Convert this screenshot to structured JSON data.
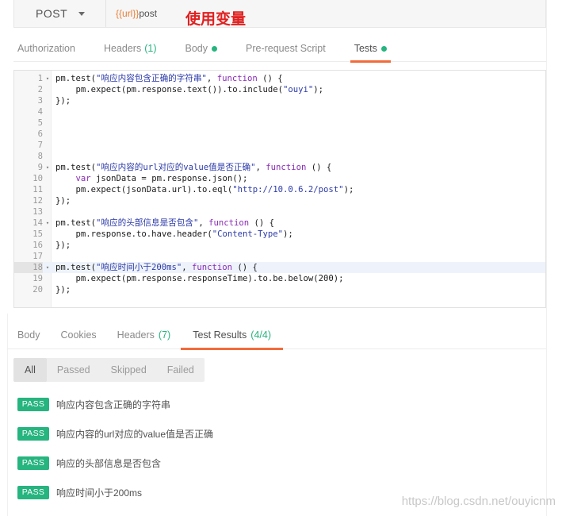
{
  "request": {
    "method": "POST",
    "url_var": "{{url}}",
    "url_rest": "post",
    "annotation": "使用变量"
  },
  "request_tabs": [
    {
      "label": "Authorization",
      "count": "",
      "dot": false,
      "active": false
    },
    {
      "label": "Headers",
      "count": "(1)",
      "dot": false,
      "active": false
    },
    {
      "label": "Body",
      "count": "",
      "dot": true,
      "active": false
    },
    {
      "label": "Pre-request Script",
      "count": "",
      "dot": false,
      "active": false
    },
    {
      "label": "Tests",
      "count": "",
      "dot": true,
      "active": true
    }
  ],
  "code_lines": [
    {
      "n": "1",
      "fold": true,
      "html": "pm.test(<span class=\"s\">\"响应内容包含正确的字符串\"</span>, <span class=\"k\">function</span> () {"
    },
    {
      "n": "2",
      "fold": false,
      "html": "    pm.expect(pm.response.text()).to.include(<span class=\"s\">\"ouyi\"</span>);"
    },
    {
      "n": "3",
      "fold": false,
      "html": "});"
    },
    {
      "n": "4",
      "fold": false,
      "html": ""
    },
    {
      "n": "5",
      "fold": false,
      "html": ""
    },
    {
      "n": "6",
      "fold": false,
      "html": ""
    },
    {
      "n": "7",
      "fold": false,
      "html": ""
    },
    {
      "n": "8",
      "fold": false,
      "html": ""
    },
    {
      "n": "9",
      "fold": true,
      "html": "pm.test(<span class=\"s\">\"响应内容的url对应的value值是否正确\"</span>, <span class=\"k\">function</span> () {"
    },
    {
      "n": "10",
      "fold": false,
      "html": "    <span class=\"k\">var</span> jsonData = pm.response.json();"
    },
    {
      "n": "11",
      "fold": false,
      "html": "    pm.expect(jsonData.url).to.eql(<span class=\"s\">\"http://10.0.6.2/post\"</span>);"
    },
    {
      "n": "12",
      "fold": false,
      "html": "});"
    },
    {
      "n": "13",
      "fold": false,
      "html": ""
    },
    {
      "n": "14",
      "fold": true,
      "html": "pm.test(<span class=\"s\">\"响应的头部信息是否包含\"</span>, <span class=\"k\">function</span> () {"
    },
    {
      "n": "15",
      "fold": false,
      "html": "    pm.response.to.have.header(<span class=\"s\">\"Content-Type\"</span>);"
    },
    {
      "n": "16",
      "fold": false,
      "html": "});"
    },
    {
      "n": "17",
      "fold": false,
      "html": ""
    },
    {
      "n": "18",
      "fold": true,
      "current": true,
      "html": "pm.test(<span class=\"s\">\"响应时间小于200ms\"</span>, <span class=\"k\">function</span> () {"
    },
    {
      "n": "19",
      "fold": false,
      "html": "    pm.expect(pm.response.responseTime).to.be.below(200);"
    },
    {
      "n": "20",
      "fold": false,
      "html": "});"
    }
  ],
  "response_tabs": [
    {
      "label": "Body",
      "count": "",
      "active": false
    },
    {
      "label": "Cookies",
      "count": "",
      "active": false
    },
    {
      "label": "Headers",
      "count": "(7)",
      "active": false
    },
    {
      "label": "Test Results",
      "count": "(4/4)",
      "active": true
    }
  ],
  "filters": [
    {
      "label": "All",
      "active": true
    },
    {
      "label": "Passed",
      "active": false
    },
    {
      "label": "Skipped",
      "active": false
    },
    {
      "label": "Failed",
      "active": false
    }
  ],
  "results": [
    {
      "status": "PASS",
      "text": "响应内容包含正确的字符串"
    },
    {
      "status": "PASS",
      "text": "响应内容的url对应的value值是否正确"
    },
    {
      "status": "PASS",
      "text": "响应的头部信息是否包含"
    },
    {
      "status": "PASS",
      "text": "响应时间小于200ms"
    }
  ],
  "watermark": "https://blog.csdn.net/ouyicnm",
  "colors": {
    "accent": "#f26b3a",
    "pass": "#26b47f",
    "annotation": "#e02020"
  }
}
